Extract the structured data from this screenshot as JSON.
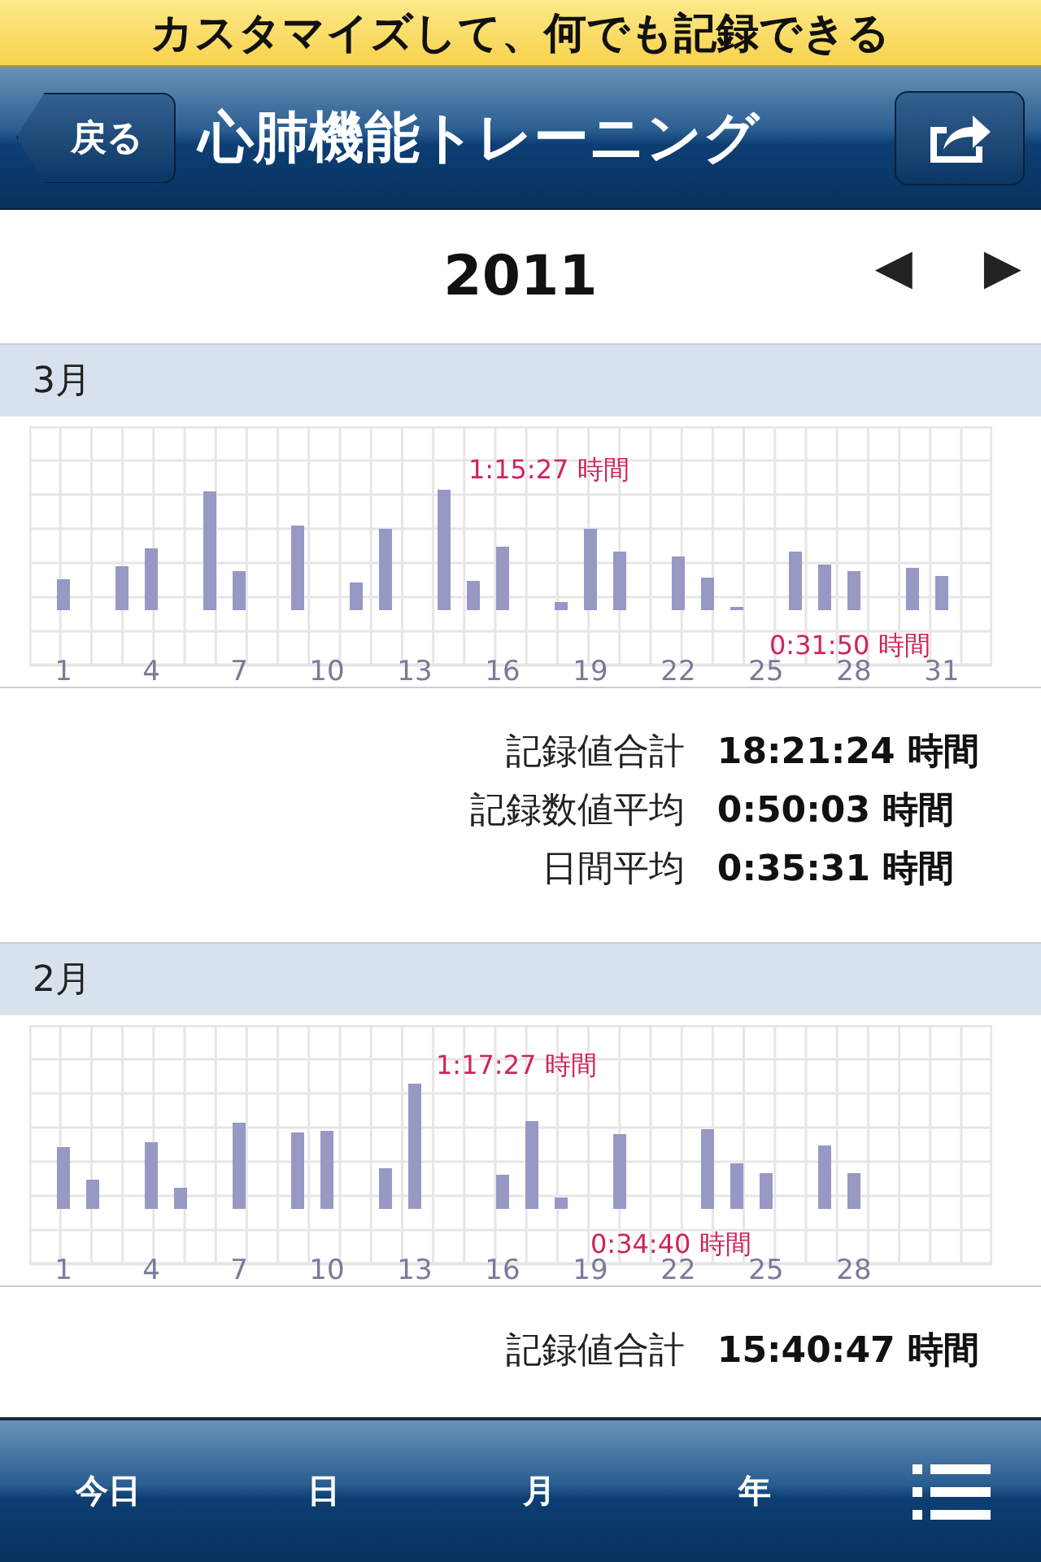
{
  "banner": {
    "text": "カスタマイズして、何でも記録できる"
  },
  "nav": {
    "back": "戻る",
    "title": "心肺機能トレーニング"
  },
  "year": {
    "label": "2011",
    "prev": "◀",
    "next": "▶"
  },
  "months": [
    {
      "title": "3月",
      "ticks": [
        "1",
        "4",
        "7",
        "10",
        "13",
        "16",
        "19",
        "22",
        "25",
        "28",
        "31"
      ],
      "max_label": "1:15:27 時間",
      "min_label": "0:31:50 時間",
      "stats": [
        {
          "label": "記録値合計",
          "value": "18:21:24 時間"
        },
        {
          "label": "記録数値平均",
          "value": "0:50:03 時間"
        },
        {
          "label": "日間平均",
          "value": "0:35:31 時間"
        }
      ]
    },
    {
      "title": "2月",
      "ticks": [
        "1",
        "4",
        "7",
        "10",
        "13",
        "16",
        "19",
        "22",
        "25",
        "28"
      ],
      "max_label": "1:17:27 時間",
      "min_label": "0:34:40 時間",
      "stats": [
        {
          "label": "記録値合計",
          "value": "15:40:47 時間"
        }
      ]
    }
  ],
  "tabs": [
    {
      "label": "今日"
    },
    {
      "label": "日"
    },
    {
      "label": "月"
    },
    {
      "label": "年"
    }
  ]
}
